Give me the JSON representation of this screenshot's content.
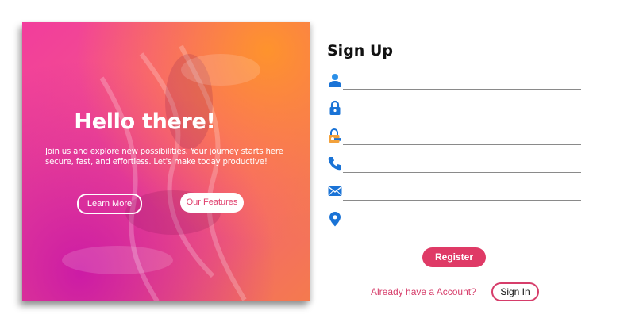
{
  "hero": {
    "title": "Hello there!",
    "subtitle": "Join us and explore new possibilities. Your journey starts here secure, fast, and effortless. Let's make today productive!",
    "learn_more_label": "Learn More",
    "features_label": "Our Features"
  },
  "form": {
    "title": "Sign Up",
    "fields": [
      {
        "icon": "user-icon",
        "value": "",
        "placeholder": ""
      },
      {
        "icon": "lock-icon",
        "value": "",
        "placeholder": ""
      },
      {
        "icon": "lock-key-icon",
        "value": "",
        "placeholder": ""
      },
      {
        "icon": "phone-icon",
        "value": "",
        "placeholder": ""
      },
      {
        "icon": "mail-icon",
        "value": "",
        "placeholder": ""
      },
      {
        "icon": "location-pin-icon",
        "value": "",
        "placeholder": ""
      }
    ],
    "register_label": "Register",
    "account_prompt": "Already have a Account?",
    "sign_in_label": "Sign In"
  },
  "colors": {
    "accent": "#df3a66",
    "hero_pink": "#f23d9c",
    "hero_orange": "#f47a4e",
    "icon_blue": "#1a73d6"
  }
}
